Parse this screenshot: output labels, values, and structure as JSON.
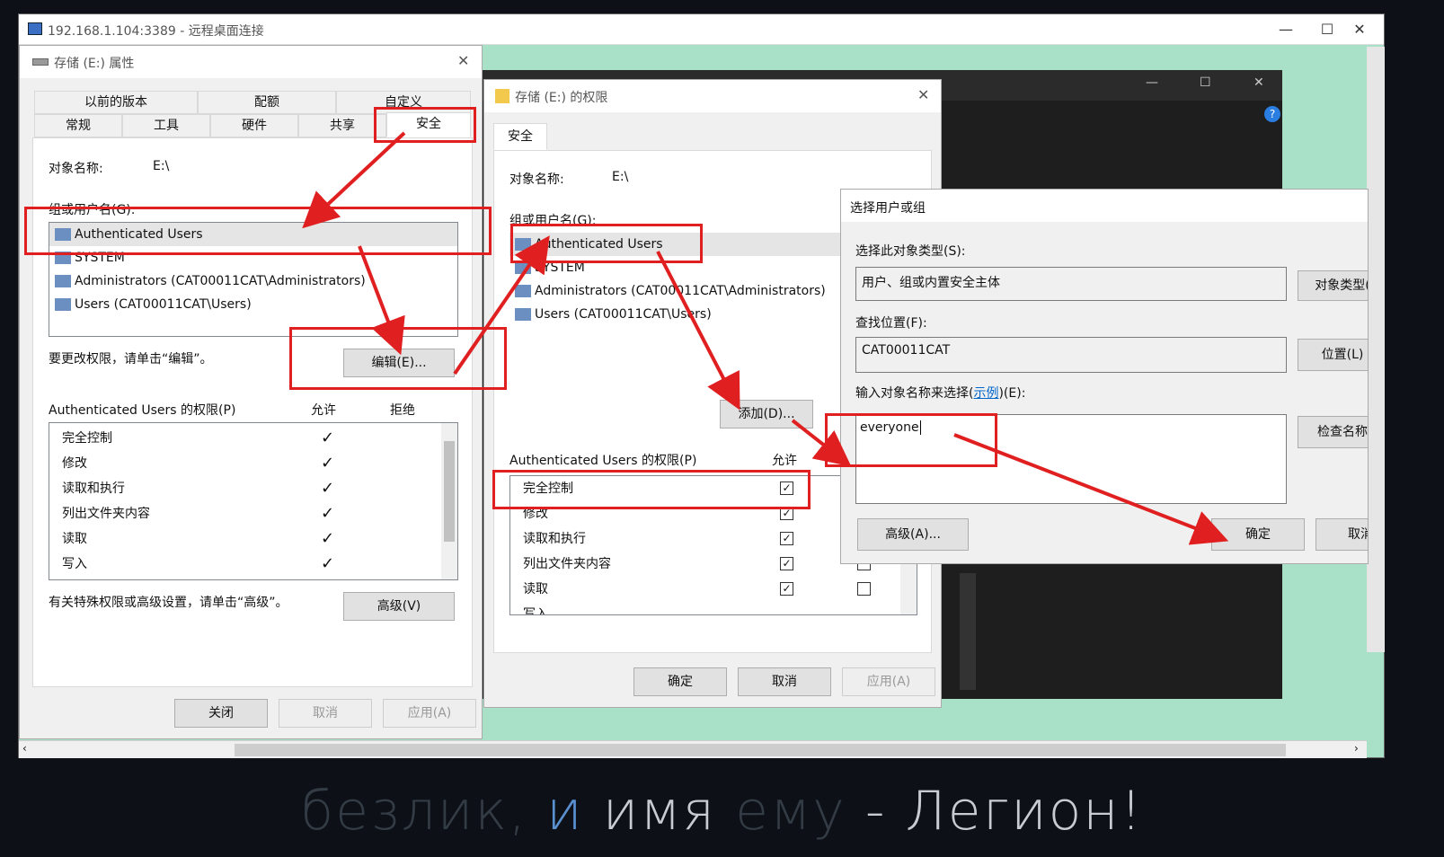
{
  "rdp": {
    "title": "192.168.1.104:3389 - 远程桌面连接",
    "min": "—",
    "max": "☐",
    "close": "✕"
  },
  "props": {
    "title": "存储 (E:) 属性",
    "tabs_row1": [
      "以前的版本",
      "配额",
      "自定义"
    ],
    "tabs_row2": [
      "常规",
      "工具",
      "硬件",
      "共享",
      "安全"
    ],
    "object_label": "对象名称:",
    "object_value": "E:\\",
    "group_label": "组或用户名(G):",
    "users": [
      "Authenticated Users",
      "SYSTEM",
      "Administrators (CAT00011CAT\\Administrators)",
      "Users (CAT00011CAT\\Users)"
    ],
    "edit_hint": "要更改权限，请单击“编辑”。",
    "edit_btn": "编辑(E)...",
    "perm_label": "Authenticated Users 的权限(P)",
    "allow": "允许",
    "deny": "拒绝",
    "perms": [
      "完全控制",
      "修改",
      "读取和执行",
      "列出文件夹内容",
      "读取",
      "写入"
    ],
    "check": "✓",
    "adv_hint": "有关特殊权限或高级设置，请单击“高级”。",
    "adv_btn": "高级(V)",
    "close_btn": "关闭",
    "cancel_btn": "取消",
    "apply_btn": "应用(A)"
  },
  "perm": {
    "title": "存储 (E:) 的权限",
    "tab": "安全",
    "object_label": "对象名称:",
    "object_value": "E:\\",
    "group_label": "组或用户名(G):",
    "users": [
      "Authenticated Users",
      "SYSTEM",
      "Administrators (CAT00011CAT\\Administrators)",
      "Users (CAT00011CAT\\Users)"
    ],
    "add_btn": "添加(D)...",
    "perm_label": "Authenticated Users 的权限(P)",
    "allow": "允许",
    "perms": [
      "完全控制",
      "修改",
      "读取和执行",
      "列出文件夹内容",
      "读取",
      "写入"
    ],
    "checkmark": "✓",
    "ok_btn": "确定",
    "cancel_btn": "取消",
    "apply_btn": "应用(A)"
  },
  "select": {
    "title": "选择用户或组",
    "type_label": "选择此对象类型(S):",
    "type_value": "用户、组或内置安全主体",
    "type_btn": "对象类型(",
    "loc_label": "查找位置(F):",
    "loc_value": "CAT00011CAT",
    "loc_btn": "位置(L)",
    "name_label": "输入对象名称来选择(",
    "name_link": "示例",
    "name_label_end": ")(E):",
    "name_value": "everyone",
    "check_btn": "检查名称",
    "adv_btn": "高级(A)...",
    "ok_btn": "确定",
    "cancel_btn": "取消"
  },
  "caption": {
    "a": "безлик, ",
    "b": "и",
    "c": " имя ",
    "d": "ему",
    "e": " - Легион!"
  },
  "colors": {
    "annotation": "#e02020",
    "link": "#0066cc"
  }
}
